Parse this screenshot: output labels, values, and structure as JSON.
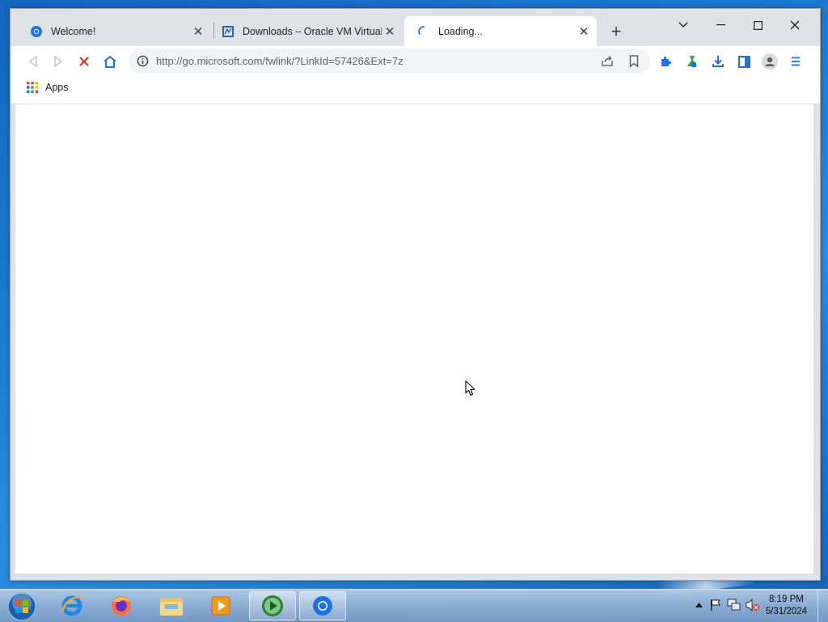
{
  "browser": {
    "tabs": [
      {
        "title": "Welcome!",
        "favicon": "chrome-icon",
        "active": false
      },
      {
        "title": "Downloads – Oracle VM VirtualBox",
        "favicon": "virtualbox-icon",
        "active": false
      },
      {
        "title": "Loading...",
        "favicon": "loading-spinner-icon",
        "active": true
      }
    ],
    "new_tab_label": "+",
    "window_controls": {
      "tab_search": "⌄",
      "minimize": "–",
      "maximize": "□",
      "close": "✕"
    },
    "address_bar": {
      "url": "http://go.microsoft.com/fwlink/?LinkId=57426&Ext=7z"
    },
    "bookmarks_bar": {
      "apps_label": "Apps"
    }
  },
  "taskbar": {
    "pinned": [
      "ie-icon",
      "firefox-icon",
      "explorer-icon",
      "media-player-icon",
      "media-center-icon",
      "chrome-icon"
    ],
    "clock": {
      "time": "8:19 PM",
      "date": "5/31/2024"
    }
  },
  "colors": {
    "accent": "#1a73e8",
    "stop": "#d93025",
    "desktop": "#1e7fd6"
  }
}
